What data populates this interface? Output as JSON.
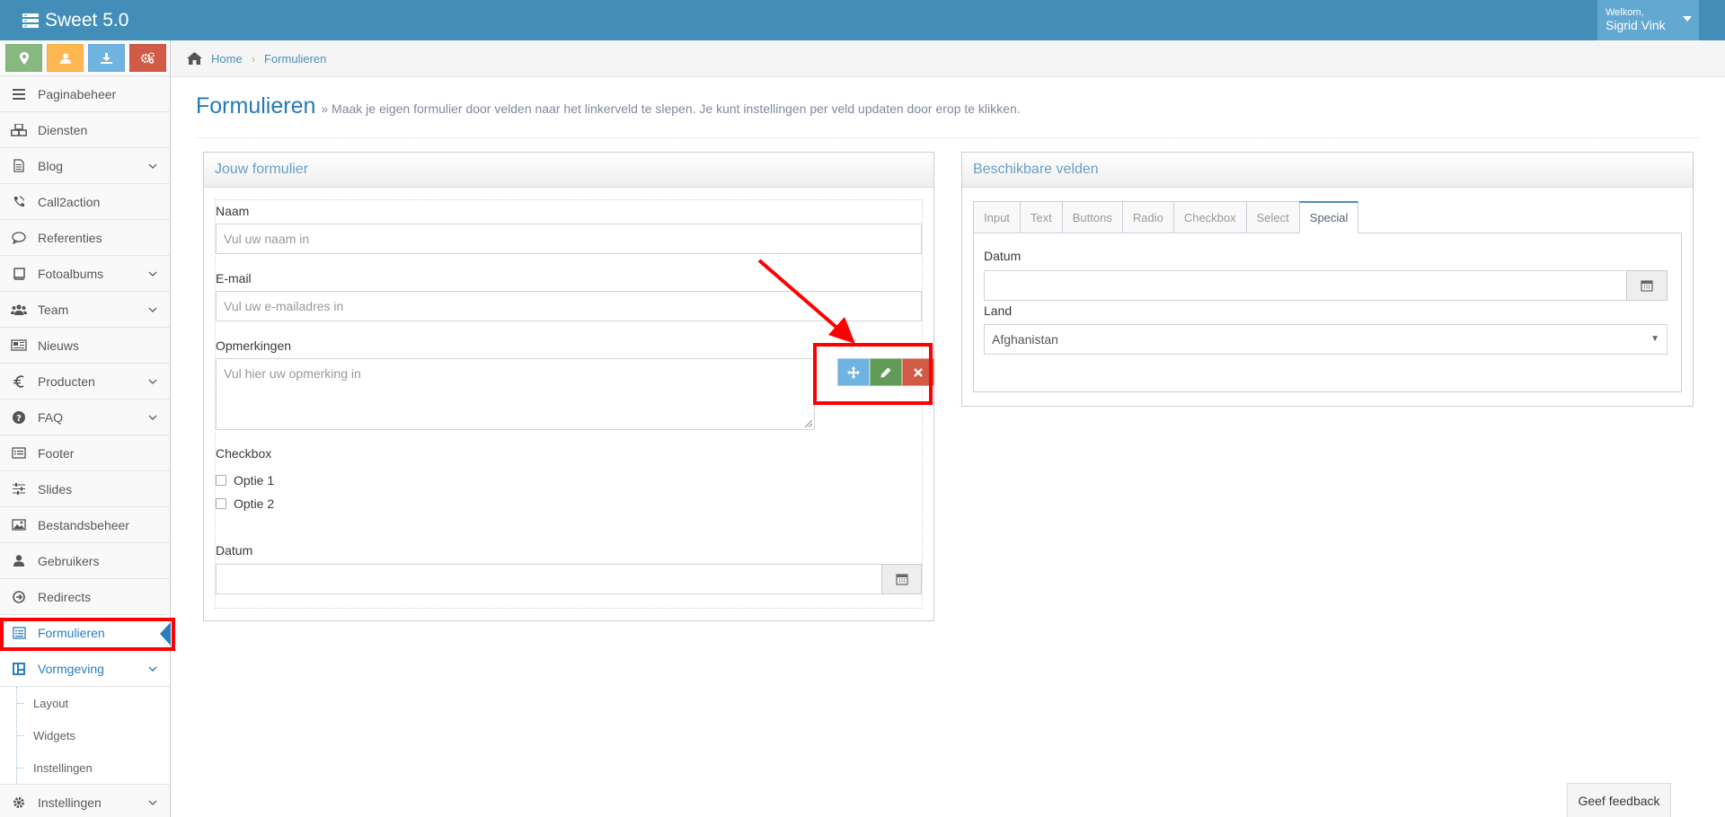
{
  "app": {
    "title": "Sweet 5.0"
  },
  "user": {
    "welcome": "Welkom,",
    "name": "Sigrid Vink"
  },
  "shortcuts": [
    {
      "icon": "map-marker-icon",
      "color": "#87b87f"
    },
    {
      "icon": "user-icon",
      "color": "#ffb752"
    },
    {
      "icon": "download-icon",
      "color": "#6fb3e0"
    },
    {
      "icon": "cogs-icon",
      "color": "#d15b47"
    }
  ],
  "sidebar": {
    "items": [
      {
        "label": "Paginabeheer",
        "icon": "bars-icon",
        "arrow": false
      },
      {
        "label": "Diensten",
        "icon": "cubes-icon",
        "arrow": false
      },
      {
        "label": "Blog",
        "icon": "file-text-icon",
        "arrow": true
      },
      {
        "label": "Call2action",
        "icon": "phone-volume-icon",
        "arrow": false
      },
      {
        "label": "Referenties",
        "icon": "comment-icon",
        "arrow": false
      },
      {
        "label": "Fotoalbums",
        "icon": "book-icon",
        "arrow": true
      },
      {
        "label": "Team",
        "icon": "users-icon",
        "arrow": true
      },
      {
        "label": "Nieuws",
        "icon": "newspaper-icon",
        "arrow": false
      },
      {
        "label": "Producten",
        "icon": "euro-icon",
        "arrow": true
      },
      {
        "label": "FAQ",
        "icon": "question-circle-icon",
        "arrow": true
      },
      {
        "label": "Footer",
        "icon": "list-alt-icon",
        "arrow": false
      },
      {
        "label": "Slides",
        "icon": "sliders-icon",
        "arrow": false
      },
      {
        "label": "Bestandsbeheer",
        "icon": "image-icon",
        "arrow": false
      },
      {
        "label": "Gebruikers",
        "icon": "user-icon",
        "arrow": false
      },
      {
        "label": "Redirects",
        "icon": "arrow-circle-right-icon",
        "arrow": false
      },
      {
        "label": "Formulieren",
        "icon": "form-icon",
        "arrow": false,
        "active": true
      },
      {
        "label": "Vormgeving",
        "icon": "columns-icon",
        "arrow": true,
        "open": true
      }
    ],
    "submenu": [
      "Layout",
      "Widgets",
      "Instellingen"
    ],
    "bottom": {
      "label": "Instellingen",
      "icon": "cog-icon"
    }
  },
  "breadcrumb": {
    "home": "Home",
    "current": "Formulieren"
  },
  "header": {
    "title": "Formulieren",
    "subtitle": "» Maak je eigen formulier door velden naar het linkerveld te slepen. Je kunt instellingen per veld updaten door erop te klikken."
  },
  "form_panel": {
    "title": "Jouw formulier",
    "name_label": "Naam",
    "name_placeholder": "Vul uw naam in",
    "email_label": "E-mail",
    "email_placeholder": "Vul uw e-mailadres in",
    "remarks_label": "Opmerkingen",
    "remarks_placeholder": "Vul hier uw opmerking in",
    "checkbox_label": "Checkbox",
    "options": [
      "Optie 1",
      "Optie 2"
    ],
    "date_label": "Datum"
  },
  "fields_panel": {
    "title": "Beschikbare velden",
    "tabs": [
      "Input",
      "Text",
      "Buttons",
      "Radio",
      "Checkbox",
      "Select",
      "Special"
    ],
    "active_tab": "Special",
    "date_label": "Datum",
    "country_label": "Land",
    "country_value": "Afghanistan"
  },
  "feedback": "Geef feedback",
  "colors": {
    "navbar": "#438eb9",
    "accent": "#2b7dbc",
    "highlight": "#ff0000"
  }
}
